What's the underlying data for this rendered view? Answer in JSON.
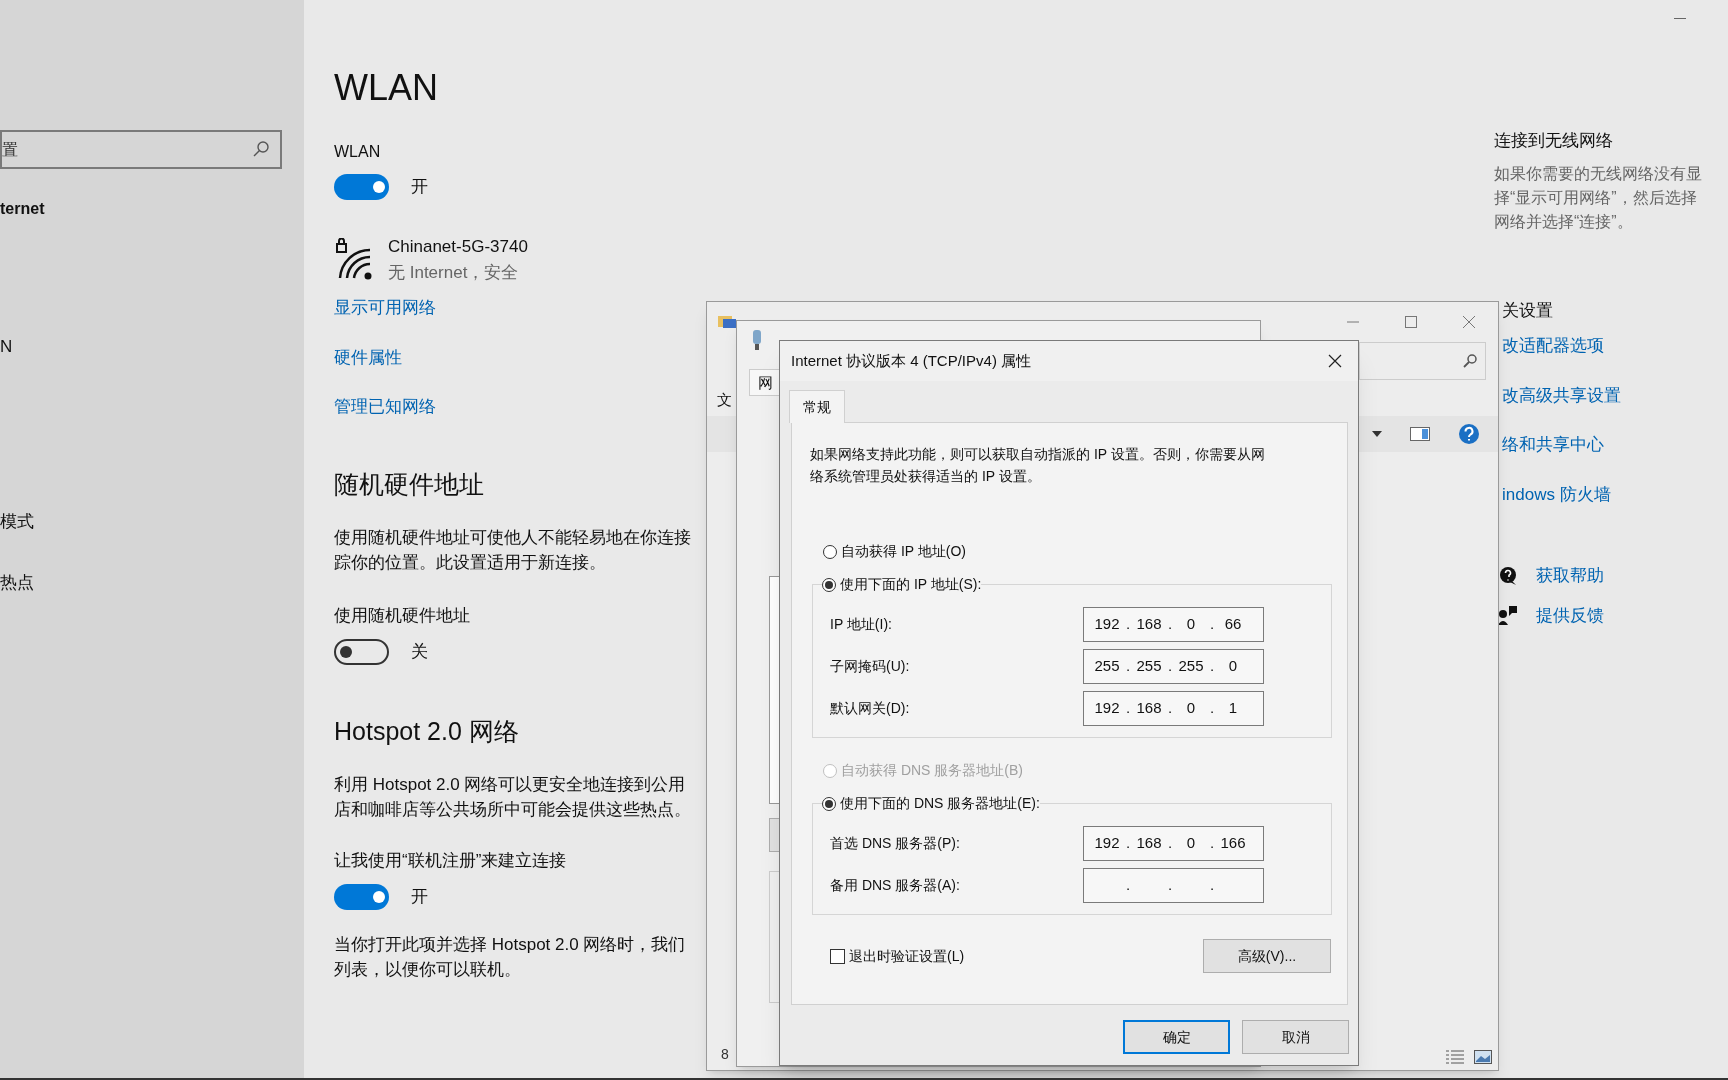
{
  "settings": {
    "sidebar": {
      "search_placeholder": "置",
      "header": "ternet",
      "items": [
        "N",
        "模式",
        "热点"
      ]
    },
    "title": "WLAN",
    "wlan": {
      "label": "WLAN",
      "on": true,
      "state_text": "开"
    },
    "network": {
      "name": "Chinanet-5G-3740",
      "status": "无 Internet，安全"
    },
    "links": [
      "显示可用网络",
      "硬件属性",
      "管理已知网络"
    ],
    "random_mac": {
      "heading": "随机硬件地址",
      "description": [
        "使用随机硬件地址可使他人不能轻易地在你连接",
        "踪你的位置。此设置适用于新连接。"
      ],
      "toggle": {
        "label": "使用随机硬件地址",
        "on": false,
        "state_text": "关"
      }
    },
    "hotspot": {
      "heading": "Hotspot 2.0 网络",
      "description": [
        "利用 Hotspot 2.0 网络可以更安全地连接到公用",
        "店和咖啡店等公共场所中可能会提供这些热点。"
      ],
      "toggle": {
        "label": "让我使用“联机注册”来建立连接",
        "on": true,
        "state_text": "开"
      },
      "note": [
        "当你打开此项并选择 Hotspot 2.0 网络时，我们",
        "列表，以便你可以联机。"
      ]
    },
    "connect_panel": {
      "heading": "连接到无线网络",
      "description": [
        "如果你需要的无线网络没有显",
        "择“显示可用网络”，然后选择",
        "网络并选择“连接”。"
      ]
    },
    "related": {
      "heading": "关设置",
      "links": [
        "改适配器选项",
        "改高级共享设置",
        "络和共享中心",
        "indows 防火墙"
      ]
    },
    "support_links": [
      {
        "kind": "help",
        "label": "获取帮助"
      },
      {
        "kind": "feedback",
        "label": "提供反馈"
      }
    ]
  },
  "network_connections_window": {
    "menu_fragment": "文",
    "status_fragment": "8"
  },
  "wlan_properties_window": {
    "tab_fragment": "网"
  },
  "ipv4_dialog": {
    "title": "Internet 协议版本 4 (TCP/IPv4) 属性",
    "tabs": [
      {
        "label": "常规",
        "selected": true
      }
    ],
    "description": "如果网络支持此功能，则可以获取自动指派的 IP 设置。否则，你需要从网络系统管理员处获得适当的 IP 设置。",
    "separator": ".",
    "ip_auto": {
      "label": "自动获得 IP 地址(O)",
      "selected": false,
      "disabled": false
    },
    "ip_manual": {
      "label": "使用下面的 IP 地址(S):",
      "selected": true,
      "disabled": false
    },
    "ip_fields": [
      {
        "label": "IP 地址(I):",
        "octets": [
          "192",
          "168",
          "0",
          "66"
        ]
      },
      {
        "label": "子网掩码(U):",
        "octets": [
          "255",
          "255",
          "255",
          "0"
        ]
      },
      {
        "label": "默认网关(D):",
        "octets": [
          "192",
          "168",
          "0",
          "1"
        ]
      }
    ],
    "dns_auto": {
      "label": "自动获得 DNS 服务器地址(B)",
      "selected": false,
      "disabled": true
    },
    "dns_manual": {
      "label": "使用下面的 DNS 服务器地址(E):",
      "selected": true,
      "disabled": false
    },
    "dns_fields": [
      {
        "label": "首选 DNS 服务器(P):",
        "octets": [
          "192",
          "168",
          "0",
          "166"
        ]
      },
      {
        "label": "备用 DNS 服务器(A):"
      }
    ],
    "validate": {
      "label": "退出时验证设置(L)",
      "checked": false
    },
    "advanced_button": "高级(V)...",
    "buttons": [
      {
        "label": "确定",
        "default": true
      },
      {
        "label": "取消",
        "default": false
      }
    ]
  }
}
